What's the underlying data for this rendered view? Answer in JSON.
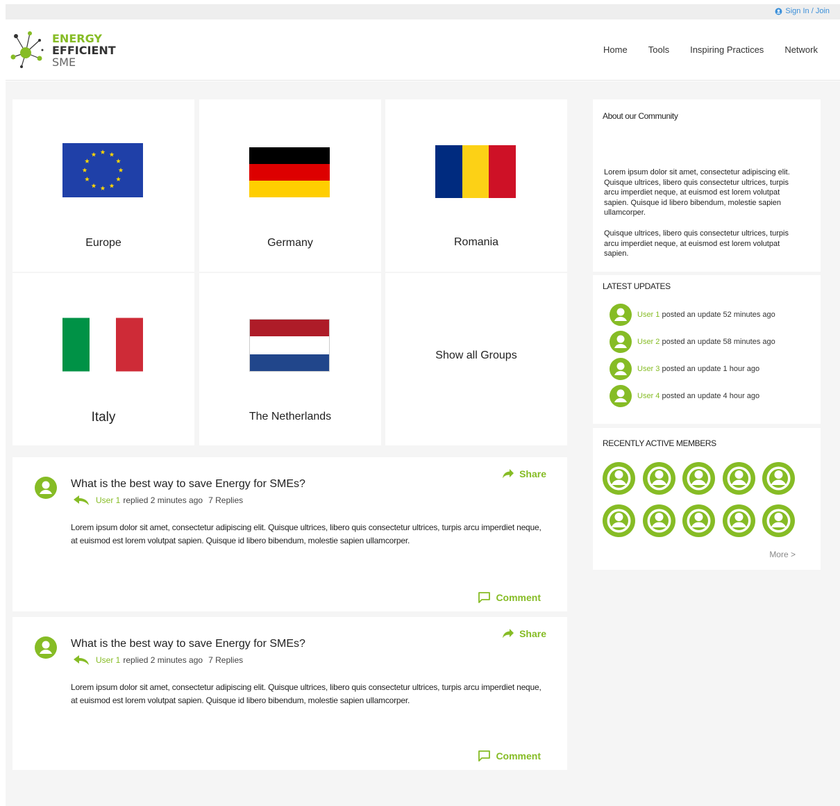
{
  "header": {
    "signin_label": "Sign In / Join",
    "logo": {
      "line1": "ENERGY",
      "line2": "EFFICIENT",
      "line3": "SME"
    },
    "nav": [
      "Home",
      "Tools",
      "Inspiring Practices",
      "Network"
    ]
  },
  "groups": [
    {
      "name": "Europe",
      "flag": "eu-flag"
    },
    {
      "name": "Germany",
      "flag": "germany-flag"
    },
    {
      "name": "Romania",
      "flag": "romania-flag"
    },
    {
      "name": "Italy",
      "flag": "italy-flag"
    },
    {
      "name": "The Netherlands",
      "flag": "netherlands-flag"
    },
    {
      "name": "Show all Groups"
    }
  ],
  "posts": [
    {
      "title": "What is the best way to save Energy for SMEs?",
      "user": "User 1",
      "replied": "replied 2 minutes ago",
      "replies": "7 Replies",
      "body": "Lorem ipsum dolor sit amet, consectetur adipiscing elit. Quisque ultrices, libero quis consectetur ultrices, turpis arcu imperdiet neque, at euismod est lorem volutpat sapien. Quisque id libero bibendum, molestie sapien ullamcorper.",
      "share_label": "Share",
      "comment_label": "Comment"
    },
    {
      "title": "What is the best way to save Energy for SMEs?",
      "user": "User 1",
      "replied": "replied 2 minutes ago",
      "replies": "7 Replies",
      "body": "Lorem ipsum dolor sit amet, consectetur adipiscing elit. Quisque ultrices, libero quis consectetur ultrices, turpis arcu imperdiet neque, at euismod est lorem volutpat sapien. Quisque id libero bibendum, molestie sapien ullamcorper.",
      "share_label": "Share",
      "comment_label": "Comment"
    }
  ],
  "about": {
    "title": "About our Community",
    "p1": "Lorem ipsum dolor sit amet, consectetur adipiscing elit. Quisque ultrices, libero quis consectetur ultrices, turpis arcu imperdiet neque, at euismod est lorem volutpat sapien. Quisque id libero bibendum, molestie sapien ullamcorper.",
    "p2": "Quisque ultrices, libero quis consectetur ultrices, turpis arcu imperdiet neque, at euismod est lorem volutpat sapien."
  },
  "updates": {
    "title": "LATEST UPDATES",
    "items": [
      {
        "user": "User 1",
        "text": "posted an update 52 minutes ago"
      },
      {
        "user": "User 2",
        "text": "posted an update 58 minutes ago"
      },
      {
        "user": "User 3",
        "text": "posted an update 1 hour ago"
      },
      {
        "user": "User 4",
        "text": "posted an update 4 hour ago"
      }
    ]
  },
  "members": {
    "title": "RECENTLY ACTIVE MEMBERS",
    "more_label": "More  >"
  },
  "colors": {
    "accent": "#86bc25",
    "link": "#3b8fd9"
  }
}
